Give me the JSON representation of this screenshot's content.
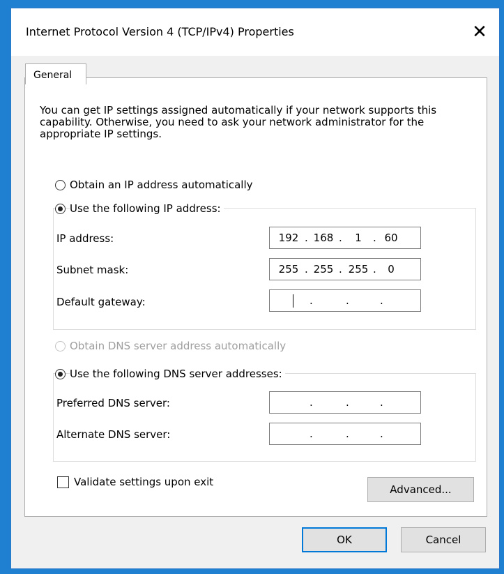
{
  "window": {
    "title": "Internet Protocol Version 4 (TCP/IPv4) Properties",
    "close_glyph": "✕"
  },
  "tabs": [
    {
      "label": "General",
      "selected": true
    }
  ],
  "intro_text": "You can get IP settings assigned automatically if your network supports this capability. Otherwise, you need to ask your network administrator for the appropriate IP settings.",
  "ip": {
    "auto_label": "Obtain an IP address automatically",
    "auto_selected": false,
    "manual_label": "Use the following IP address:",
    "manual_selected": true,
    "fields": [
      {
        "label": "IP address:",
        "octets": [
          "192",
          "168",
          "1",
          "60"
        ]
      },
      {
        "label": "Subnet mask:",
        "octets": [
          "255",
          "255",
          "255",
          "0"
        ]
      },
      {
        "label": "Default gateway:",
        "octets": [
          "",
          "",
          "",
          ""
        ],
        "focused": true
      }
    ]
  },
  "dns": {
    "auto_label": "Obtain DNS server address automatically",
    "auto_selected": false,
    "auto_disabled": true,
    "manual_label": "Use the following DNS server addresses:",
    "manual_selected": true,
    "fields": [
      {
        "label": "Preferred DNS server:",
        "octets": [
          "",
          "",
          "",
          ""
        ]
      },
      {
        "label": "Alternate DNS server:",
        "octets": [
          "",
          "",
          "",
          ""
        ]
      }
    ]
  },
  "validate": {
    "label": "Validate settings upon exit",
    "checked": false
  },
  "buttons": {
    "advanced": "Advanced...",
    "ok": "OK",
    "cancel": "Cancel"
  },
  "colors": {
    "accent": "#0078d7",
    "desktop": "#1f7fd0",
    "dialog_bg": "#f0f0f0"
  }
}
